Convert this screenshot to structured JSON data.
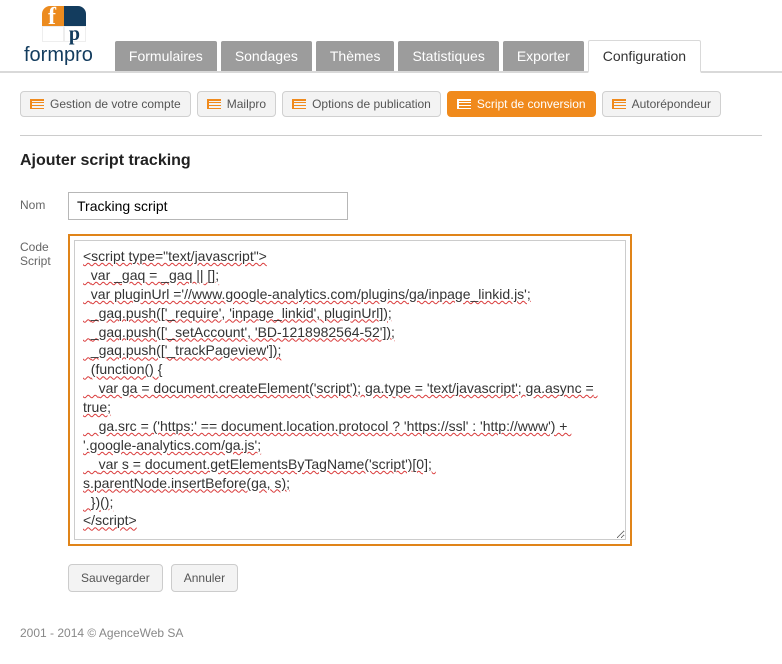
{
  "brand": "formpro",
  "mainNav": {
    "items": [
      {
        "label": "Formulaires",
        "active": false
      },
      {
        "label": "Sondages",
        "active": false
      },
      {
        "label": "Thèmes",
        "active": false
      },
      {
        "label": "Statistiques",
        "active": false
      },
      {
        "label": "Exporter",
        "active": false
      },
      {
        "label": "Configuration",
        "active": true
      }
    ]
  },
  "subNav": {
    "items": [
      {
        "label": "Gestion de votre compte",
        "active": false
      },
      {
        "label": "Mailpro",
        "active": false
      },
      {
        "label": "Options de publication",
        "active": false
      },
      {
        "label": "Script de conversion",
        "active": true
      },
      {
        "label": "Autorépondeur",
        "active": false
      }
    ]
  },
  "page": {
    "title": "Ajouter script tracking",
    "nameLabel": "Nom",
    "codeLabel": "Code Script",
    "nameValue": "Tracking script",
    "codeValue": "<script type=\"text/javascript\">\n  var _gaq = _gaq || [];\n  var pluginUrl ='//www.google-analytics.com/plugins/ga/inpage_linkid.js';\n  _gaq.push(['_require', 'inpage_linkid', pluginUrl]);\n  _gaq.push(['_setAccount', 'BD-1218982564-52']);\n  _gaq.push(['_trackPageview']);\n  (function() {\n    var ga = document.createElement('script'); ga.type = 'text/javascript'; ga.async = true;\n    ga.src = ('https:' == document.location.protocol ? 'https://ssl' : 'http://www') + '.google-analytics.com/ga.js';\n    var s = document.getElementsByTagName('script')[0]; s.parentNode.insertBefore(ga, s);\n  })();\n</script>",
    "saveLabel": "Sauvegarder",
    "cancelLabel": "Annuler"
  },
  "footer": "2001 - 2014 © AgenceWeb SA"
}
